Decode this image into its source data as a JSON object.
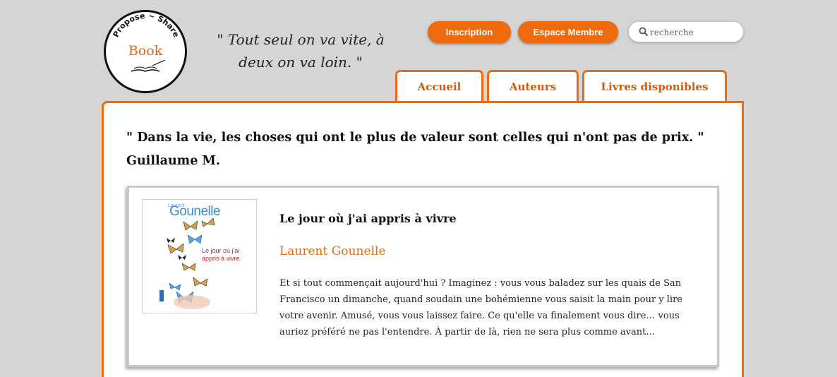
{
  "logo": {
    "line1": "Propose ~ Share",
    "word": "Book"
  },
  "motto": "\" Tout seul on va vite, à deux on va loin. \"",
  "header": {
    "inscription": "Inscription",
    "espace_membre": "Espace Membre",
    "search_placeholder": "recherche"
  },
  "tabs": [
    {
      "label": "Accueil"
    },
    {
      "label": "Auteurs"
    },
    {
      "label": "Livres disponibles"
    }
  ],
  "quote": {
    "text": "\" Dans la vie, les choses qui ont le plus de valeur sont celles qui n'ont pas de prix. \"",
    "author": "Guillaume M."
  },
  "book": {
    "cover": {
      "author_first": "Laurent",
      "author_last": "Gounelle",
      "title": "Le jour où j'ai appris à vivre"
    },
    "title": "Le jour où j'ai appris à vivre",
    "author": "Laurent Gounelle",
    "description": "Et si tout commençait aujourd'hui ? Imaginez : vous vous baladez sur les quais de San Francisco un dimanche, quand soudain une bohémienne vous saisit la main pour y lire votre avenir. Amusé, vous vous laissez faire. Ce qu'elle va finalement vous dire… vous auriez préféré ne pas l'entendre. À partir de là, rien ne sera plus comme avant…"
  },
  "colors": {
    "accent": "#ee6a0c",
    "background": "#d5d5d5"
  }
}
